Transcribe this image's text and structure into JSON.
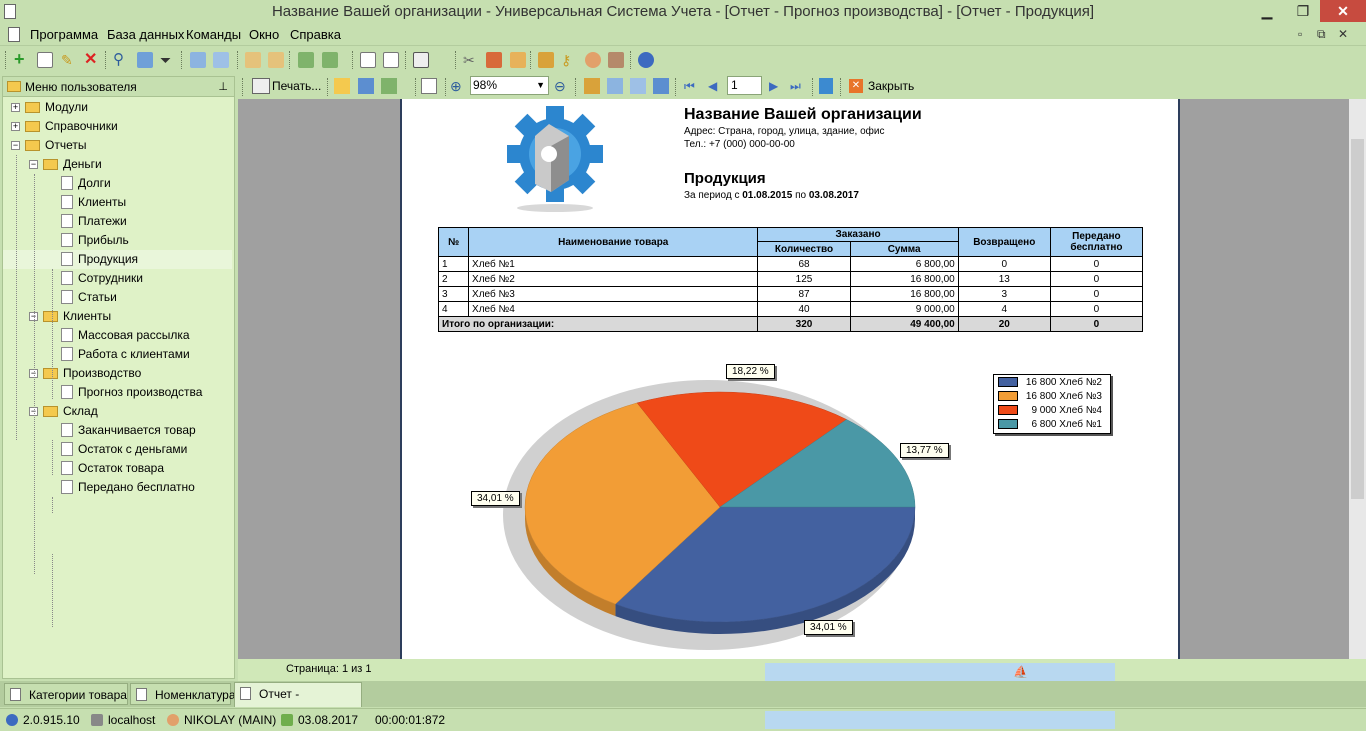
{
  "window": {
    "title": "Название Вашей организации - Универсальная Система Учета - [Отчет - Прогноз производства] - [Отчет - Продукция]"
  },
  "menu": [
    "Программа",
    "База данных",
    "Команды",
    "Окно",
    "Справка"
  ],
  "left_panel": {
    "title": "Меню пользователя",
    "tree": [
      {
        "label": "Модули",
        "level": 0,
        "type": "folder",
        "expander": "+"
      },
      {
        "label": "Справочники",
        "level": 0,
        "type": "folder",
        "expander": "+"
      },
      {
        "label": "Отчеты",
        "level": 0,
        "type": "folder",
        "expander": "−"
      },
      {
        "label": "Деньги",
        "level": 1,
        "type": "folder",
        "expander": "−"
      },
      {
        "label": "Долги",
        "level": 2,
        "type": "doc"
      },
      {
        "label": "Клиенты",
        "level": 2,
        "type": "doc"
      },
      {
        "label": "Платежи",
        "level": 2,
        "type": "doc"
      },
      {
        "label": "Прибыль",
        "level": 2,
        "type": "doc"
      },
      {
        "label": "Продукция",
        "level": 2,
        "type": "doc",
        "selected": true
      },
      {
        "label": "Сотрудники",
        "level": 2,
        "type": "doc"
      },
      {
        "label": "Статьи",
        "level": 2,
        "type": "doc"
      },
      {
        "label": "Клиенты",
        "level": 1,
        "type": "folder",
        "expander": "−"
      },
      {
        "label": "Массовая рассылка",
        "level": 2,
        "type": "doc"
      },
      {
        "label": "Работа с клиентами",
        "level": 2,
        "type": "doc"
      },
      {
        "label": "Производство",
        "level": 1,
        "type": "folder",
        "expander": "−"
      },
      {
        "label": "Прогноз производства",
        "level": 2,
        "type": "doc"
      },
      {
        "label": "Склад",
        "level": 1,
        "type": "folder",
        "expander": "−"
      },
      {
        "label": "Заканчивается товар",
        "level": 2,
        "type": "doc"
      },
      {
        "label": "Остаток с деньгами",
        "level": 2,
        "type": "doc"
      },
      {
        "label": "Остаток товара",
        "level": 2,
        "type": "doc"
      },
      {
        "label": "Передано бесплатно",
        "level": 2,
        "type": "doc"
      }
    ]
  },
  "report_toolbar": {
    "print": "Печать...",
    "zoom": "98%",
    "page": "1",
    "close": "Закрыть"
  },
  "report": {
    "org_name": "Название Вашей организации",
    "address": "Адрес: Страна, город, улица, здание, офис",
    "phone": "Тел.: +7 (000) 000-00-00",
    "title": "Продукция",
    "period_prefix": "За период с ",
    "period_from": "01.08.2015",
    "period_mid": " по ",
    "period_to": "03.08.2017",
    "headers": {
      "num": "№",
      "name": "Наименование товара",
      "ordered": "Заказано",
      "qty": "Количество",
      "sum": "Сумма",
      "returned": "Возвращено",
      "free": "Передано бесплатно"
    },
    "rows": [
      {
        "num": "1",
        "name": "Хлеб №1",
        "qty": "68",
        "sum": "6 800,00",
        "returned": "0",
        "free": "0"
      },
      {
        "num": "2",
        "name": "Хлеб №2",
        "qty": "125",
        "sum": "16 800,00",
        "returned": "13",
        "free": "0"
      },
      {
        "num": "3",
        "name": "Хлеб №3",
        "qty": "87",
        "sum": "16 800,00",
        "returned": "3",
        "free": "0"
      },
      {
        "num": "4",
        "name": "Хлеб №4",
        "qty": "40",
        "sum": "9 000,00",
        "returned": "4",
        "free": "0"
      }
    ],
    "total": {
      "label": "Итого по организации:",
      "qty": "320",
      "sum": "49 400,00",
      "returned": "20",
      "free": "0"
    }
  },
  "chart_data": {
    "type": "pie",
    "legend_position": "top-right",
    "slices": [
      {
        "label": "16 800 Хлеб №2",
        "value": 16800,
        "percent_label": "34,01 %",
        "color": "#4361a0"
      },
      {
        "label": "16 800 Хлеб №3",
        "value": 16800,
        "percent_label": "34,01 %",
        "color": "#f29d36"
      },
      {
        "label": "9 000 Хлеб №4",
        "value": 9000,
        "percent_label": "18,22 %",
        "color": "#ef4a18"
      },
      {
        "label": "6 800 Хлеб №1",
        "value": 6800,
        "percent_label": "13,77 %",
        "color": "#4a98a6"
      }
    ]
  },
  "viewer_status": "Страница: 1 из 1",
  "tabs": [
    "Категории товара",
    "Номенклатура",
    "Отчет - Продукция"
  ],
  "statusbar": {
    "version": "2.0.915.10",
    "server": "localhost",
    "user": "NIKOLAY (MAIN)",
    "date": "03.08.2017",
    "timer": "00:00:01:872"
  }
}
